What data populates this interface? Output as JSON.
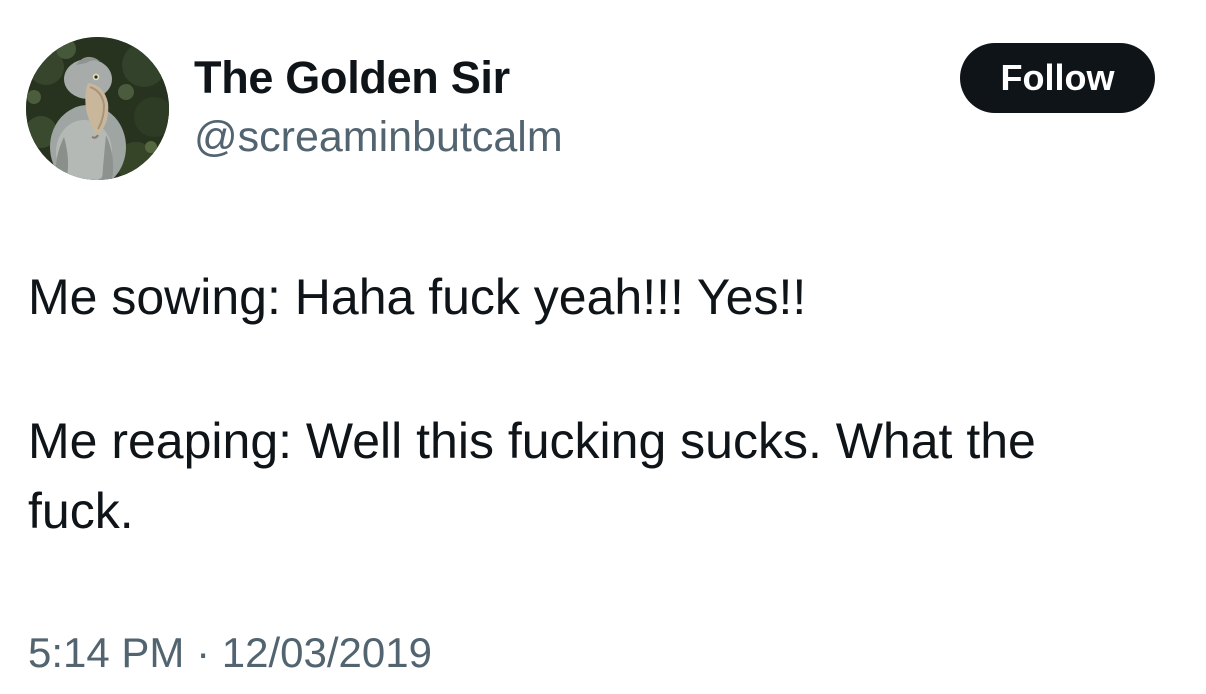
{
  "author": {
    "display_name": "The Golden Sir",
    "handle": "@screaminbutcalm",
    "avatar_icon": "shoebill-bird-photo"
  },
  "actions": {
    "follow_label": "Follow"
  },
  "tweet": {
    "lines": [
      "Me sowing: Haha fuck yeah!!! Yes!!",
      "Me reaping: Well this fucking sucks. What the",
      "fuck."
    ]
  },
  "meta": {
    "time": "5:14 PM",
    "separator": " · ",
    "date": "12/03/2019"
  },
  "colors": {
    "text_primary": "#0f1419",
    "text_secondary": "#536471",
    "button_bg": "#0f1419",
    "button_text": "#ffffff",
    "background": "#ffffff"
  }
}
